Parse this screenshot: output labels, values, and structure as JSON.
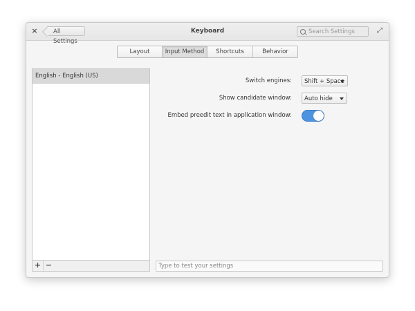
{
  "window": {
    "title": "Keyboard",
    "back_label": "All Settings",
    "close_glyph": "×",
    "maximize_glyph": "⤢",
    "search_placeholder": "Search Settings"
  },
  "tabs": [
    {
      "label": "Layout",
      "active": false
    },
    {
      "label": "Input Method",
      "active": true
    },
    {
      "label": "Shortcuts",
      "active": false
    },
    {
      "label": "Behavior",
      "active": false
    }
  ],
  "engines_list": {
    "items": [
      {
        "label": "English - English (US)",
        "selected": true
      }
    ],
    "add_glyph": "+",
    "remove_glyph": "−"
  },
  "settings": {
    "switch_engines": {
      "label": "Switch engines:",
      "value": "Shift + Space"
    },
    "show_candidate_window": {
      "label": "Show candidate window:",
      "value": "Auto hide"
    },
    "embed_preedit": {
      "label": "Embed preedit text in application window:",
      "on": true
    }
  },
  "test_field": {
    "placeholder": "Type to test your settings",
    "value": ""
  },
  "colors": {
    "accent": "#4d94e0"
  }
}
